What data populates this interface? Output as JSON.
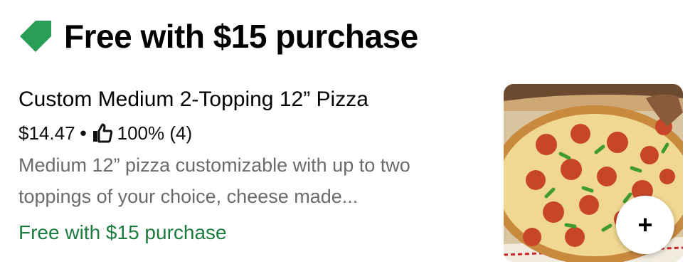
{
  "section": {
    "title": "Free with $15 purchase",
    "icon": "tag-icon",
    "icon_color": "#2a9d56"
  },
  "item": {
    "name": "Custom Medium 2-Topping 12” Pizza",
    "price": "$14.47",
    "separator": "•",
    "rating_icon": "thumbs-up-icon",
    "rating": "100% (4)",
    "description": "Medium 12” pizza customizable with up to two toppings of your choice, cheese made...",
    "promo": "Free with $15 purchase",
    "promo_color": "#1c7c3d",
    "image_alt": "pepperoni and green pepper pizza in box",
    "add_label": "+"
  }
}
